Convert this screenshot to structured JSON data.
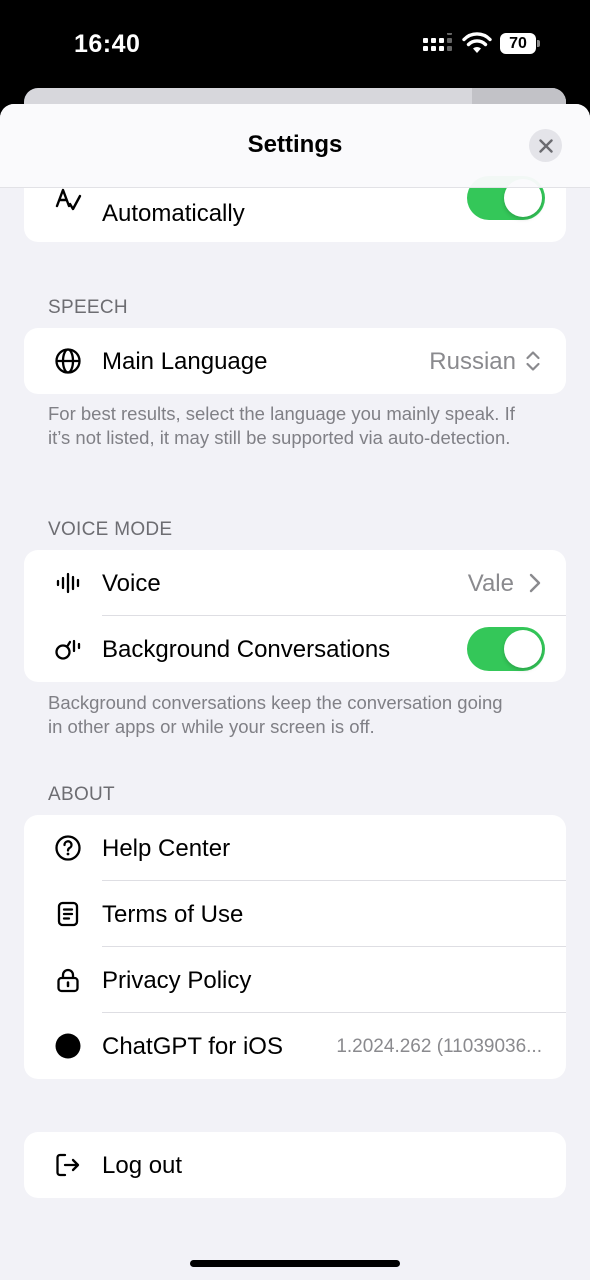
{
  "status_bar": {
    "time": "16:40",
    "battery": "70"
  },
  "nav": {
    "title": "Settings"
  },
  "top_row": {
    "label": "Automatically",
    "toggle_on": true
  },
  "speech": {
    "header": "SPEECH",
    "main_language": {
      "label": "Main Language",
      "value": "Russian"
    },
    "footer": "For best results, select the language you mainly speak. If it’s not listed, it may still be supported via auto-detection."
  },
  "voice_mode": {
    "header": "VOICE MODE",
    "voice": {
      "label": "Voice",
      "value": "Vale"
    },
    "background": {
      "label": "Background Conversations",
      "toggle_on": true
    },
    "footer": "Background conversations keep the conversation going in other apps or while your screen is off."
  },
  "about": {
    "header": "ABOUT",
    "help": {
      "label": "Help Center"
    },
    "terms": {
      "label": "Terms of Use"
    },
    "privacy": {
      "label": "Privacy Policy"
    },
    "app": {
      "label": "ChatGPT for iOS",
      "value": "1.2024.262 (11039036..."
    }
  },
  "logout": {
    "label": "Log out"
  },
  "icons": {
    "text_correction": "a-with-check-icon",
    "globe": "globe-icon",
    "voice": "waveform-icon",
    "background": "speaker-wave-icon",
    "help": "question-circle-icon",
    "terms": "document-list-icon",
    "privacy": "lock-icon",
    "app": "openai-logo-icon",
    "logout": "logout-arrow-icon"
  },
  "colors": {
    "accent_toggle": "#34c759",
    "background": "#f2f2f7",
    "secondary_text": "#8a8a8e"
  }
}
